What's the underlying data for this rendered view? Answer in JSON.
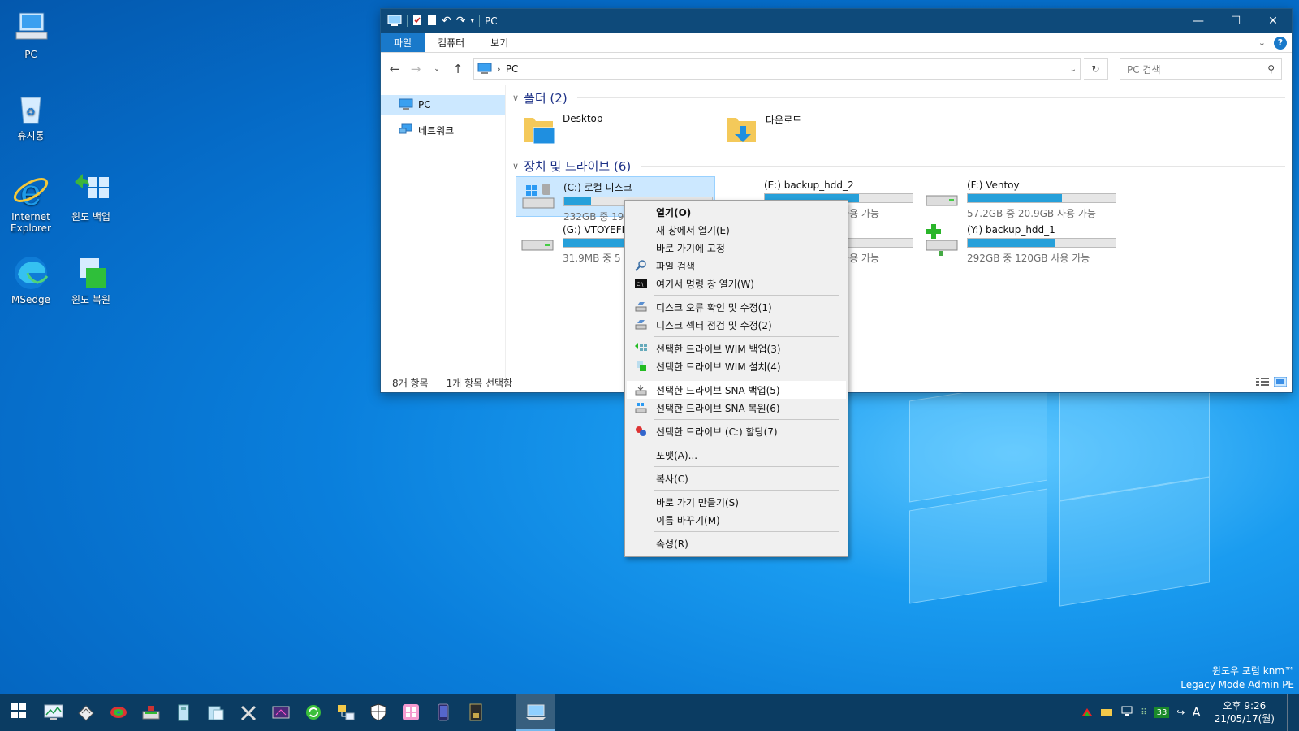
{
  "desktop": {
    "icons": [
      {
        "label": "PC"
      },
      {
        "label": "휴지통"
      },
      {
        "label": "Internet Explorer"
      },
      {
        "label": "윈도 백업"
      },
      {
        "label": "MSedge"
      },
      {
        "label": "윈도 복원"
      }
    ],
    "watermark": [
      "윈도우 포럼 knm™",
      "Legacy Mode Admin PE"
    ]
  },
  "window": {
    "title": "PC",
    "ribbon_tabs": [
      "파일",
      "컴퓨터",
      "보기"
    ],
    "address_path": "PC",
    "search_placeholder": "PC 검색",
    "nav": [
      {
        "label": "PC",
        "selected": true
      },
      {
        "label": "네트워크",
        "selected": false
      }
    ],
    "folders_header": "폴더 (2)",
    "folders": [
      {
        "name": "Desktop",
        "icon": "desktop-folder-icon"
      },
      {
        "name": "다운로드",
        "icon": "downloads-folder-icon"
      }
    ],
    "drives_header": "장치 및 드라이브 (6)",
    "drives": [
      {
        "name": "(C:) 로컬 디스크",
        "free": "232GB 중 19",
        "fill": 0.18,
        "selected": true
      },
      {
        "name": "(E:) backup_hdd_2",
        "free": "사용 가능",
        "fill": 0.64,
        "selected": false
      },
      {
        "name": "(F:) Ventoy",
        "free": "57.2GB 중 20.9GB 사용 가능",
        "fill": 0.64,
        "selected": false
      },
      {
        "name": "(G:) VTOYEFI",
        "free": "31.9MB 중 5",
        "fill": 0.84,
        "selected": false
      },
      {
        "name": "",
        "free": "사용 가능",
        "fill": 0.5,
        "selected": false
      },
      {
        "name": "(Y:) backup_hdd_1",
        "free": "292GB 중 120GB 사용 가능",
        "fill": 0.59,
        "selected": false
      }
    ],
    "status": {
      "items": "8개 항목",
      "selected": "1개 항목 선택함"
    }
  },
  "context_menu": [
    {
      "label": "열기(O)",
      "bold": true
    },
    {
      "label": "새 창에서 열기(E)"
    },
    {
      "label": "바로 가기에 고정"
    },
    {
      "label": "파일 검색",
      "icon": "search-icon"
    },
    {
      "label": "여기서 명령 창 열기(W)",
      "icon": "cmd-icon"
    },
    {
      "sep": true
    },
    {
      "label": "디스크 오류 확인 및 수정(1)",
      "icon": "disk-check-icon"
    },
    {
      "label": "디스크 섹터 점검 및 수정(2)",
      "icon": "disk-check-icon"
    },
    {
      "sep": true
    },
    {
      "label": "선택한 드라이브 WIM 백업(3)",
      "icon": "wim-backup-icon"
    },
    {
      "label": "선택한 드라이브 WIM 설치(4)",
      "icon": "wim-install-icon"
    },
    {
      "sep": true
    },
    {
      "label": "선택한 드라이브 SNA 백업(5)",
      "icon": "sna-backup-icon",
      "highlight": true
    },
    {
      "label": "선택한 드라이브 SNA 복원(6)",
      "icon": "sna-restore-icon"
    },
    {
      "sep": true
    },
    {
      "label": "선택한 드라이브 (C:) 할당(7)",
      "icon": "assign-icon"
    },
    {
      "sep": true
    },
    {
      "label": "포맷(A)..."
    },
    {
      "sep": true
    },
    {
      "label": "복사(C)"
    },
    {
      "sep": true
    },
    {
      "label": "바로 가기 만들기(S)"
    },
    {
      "label": "이름 바꾸기(M)"
    },
    {
      "sep": true
    },
    {
      "label": "속성(R)"
    }
  ],
  "taskbar": {
    "pinned": [
      "start-icon",
      "task-manager-icon",
      "disk-tool-icon",
      "partition-icon",
      "backup-tool-icon",
      "registry-icon",
      "explorer-icon",
      "tools-icon",
      "media-icon",
      "sync-icon",
      "network-icon",
      "shield-icon",
      "app-icon",
      "phone-icon",
      "card-icon",
      "active-explorer-icon"
    ],
    "tray_badge": "33",
    "ime": "A",
    "time": "오후 9:26",
    "date": "21/05/17(월)"
  },
  "colors": {
    "titlebar": "#0e4a7a",
    "accent": "#1979ca",
    "selection": "#cce8ff",
    "drive_bar": "#26a0da",
    "taskbar": "#0b3c62"
  }
}
